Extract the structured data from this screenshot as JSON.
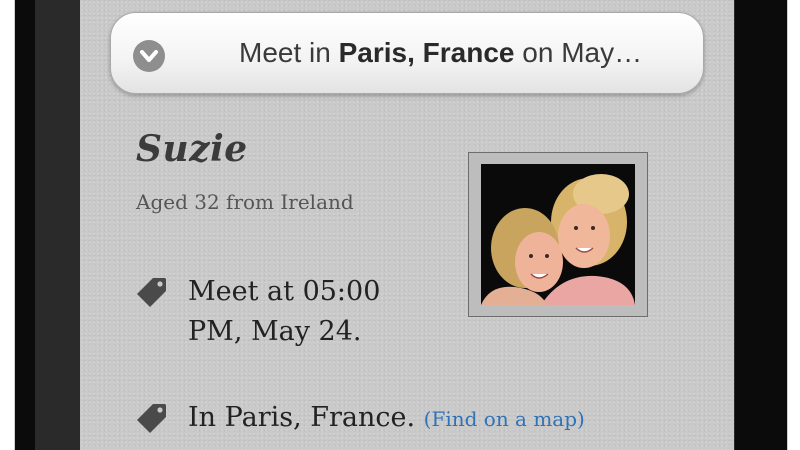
{
  "header": {
    "prefix": "Meet in ",
    "location": "Paris, France",
    "suffix": " on May…",
    "expand_icon": "chevron-down-icon"
  },
  "profile": {
    "name": "Suzie",
    "subtitle": "Aged 32 from Ireland",
    "photo_alt": "Profile photo of two smiling women"
  },
  "details": [
    {
      "icon": "tag-icon",
      "text": "Meet at 05:00 PM, May 24."
    },
    {
      "icon": "tag-icon",
      "text": "In Paris, France.",
      "link_label": "(Find on a map)"
    }
  ],
  "colors": {
    "background": "#c9c9c9",
    "link": "#2f72b7",
    "text": "#222222"
  }
}
